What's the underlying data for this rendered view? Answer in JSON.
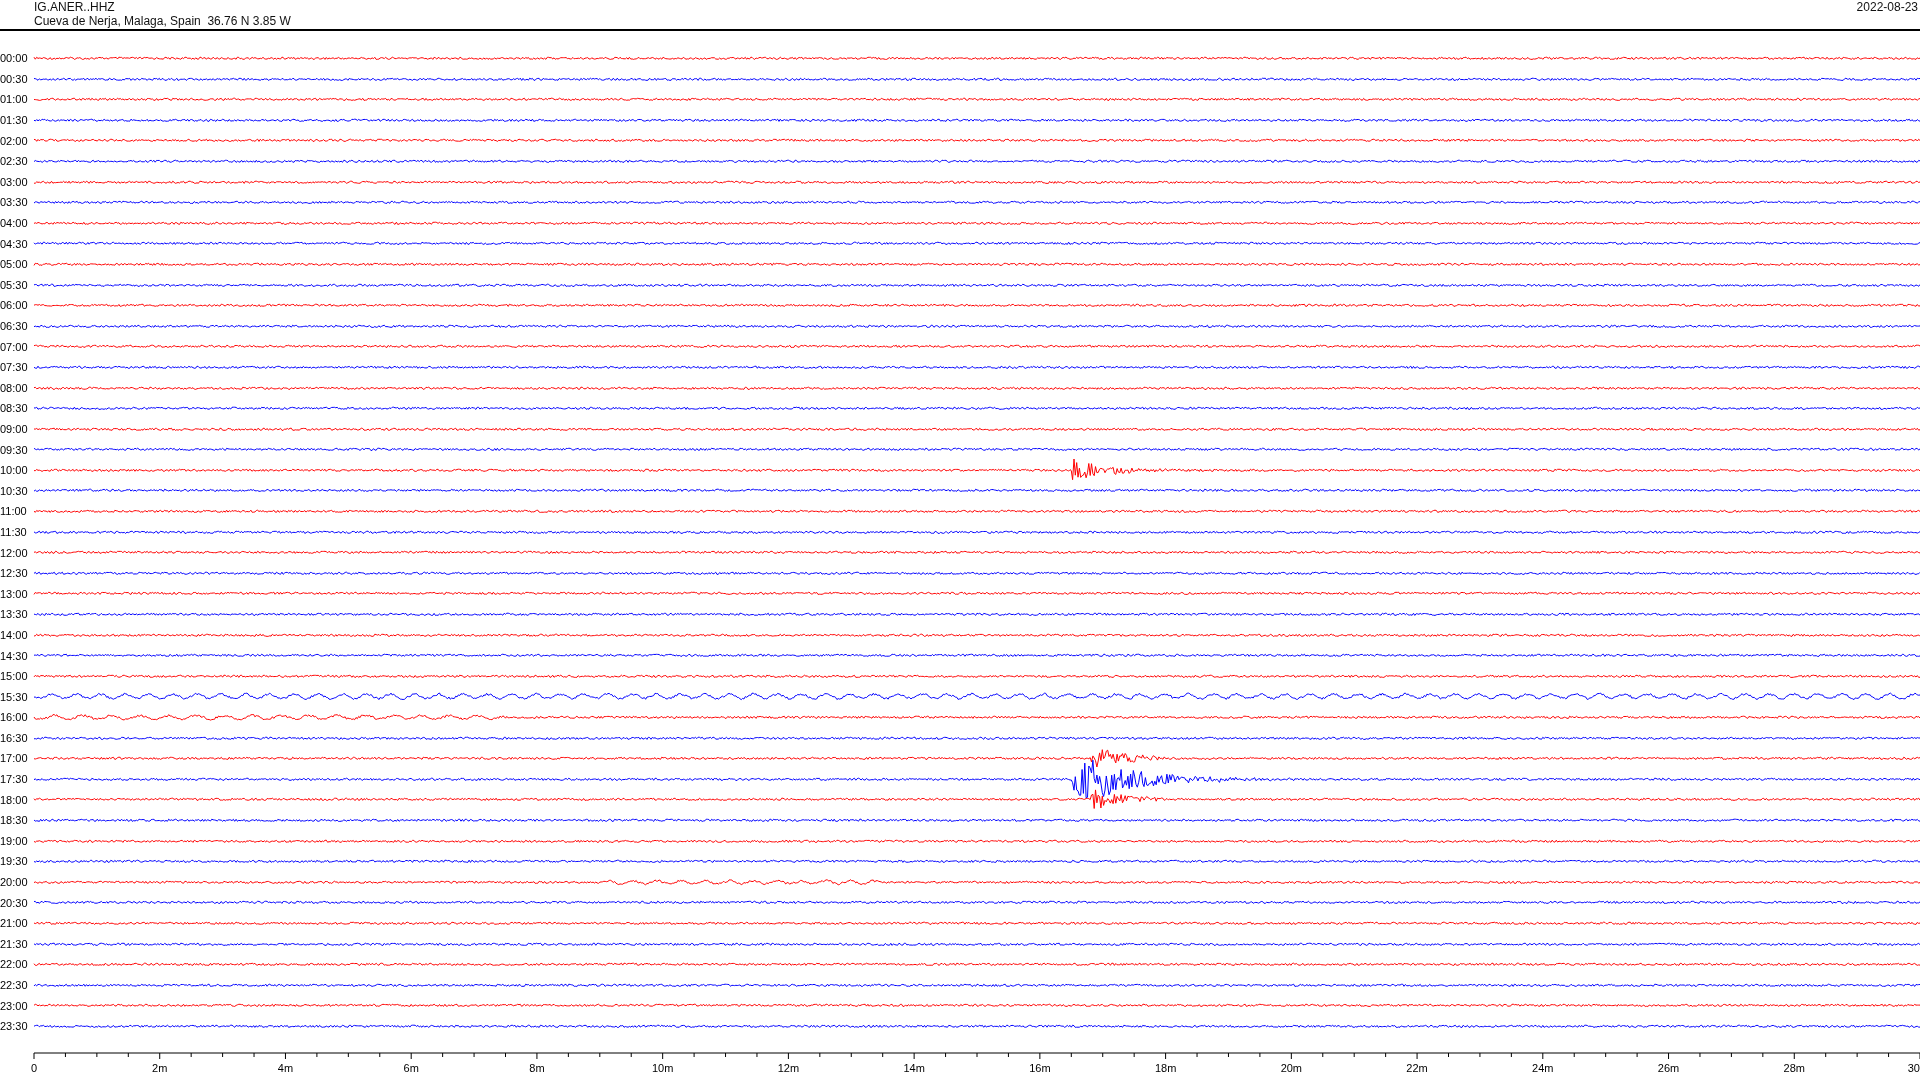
{
  "header": {
    "station": "IG.ANER..HHZ",
    "location": "Cueva de Nerja, Malaga, Spain  36.76 N 3.85 W",
    "date": "2022-08-23"
  },
  "traces": [
    {
      "time": "00:00",
      "color": "#ff0000"
    },
    {
      "time": "00:30",
      "color": "#0000ff"
    },
    {
      "time": "01:00",
      "color": "#ff0000"
    },
    {
      "time": "01:30",
      "color": "#0000ff"
    },
    {
      "time": "02:00",
      "color": "#ff0000"
    },
    {
      "time": "02:30",
      "color": "#0000ff"
    },
    {
      "time": "03:00",
      "color": "#ff0000"
    },
    {
      "time": "03:30",
      "color": "#0000ff"
    },
    {
      "time": "04:00",
      "color": "#ff0000"
    },
    {
      "time": "04:30",
      "color": "#0000ff"
    },
    {
      "time": "05:00",
      "color": "#ff0000"
    },
    {
      "time": "05:30",
      "color": "#0000ff"
    },
    {
      "time": "06:00",
      "color": "#ff0000"
    },
    {
      "time": "06:30",
      "color": "#0000ff"
    },
    {
      "time": "07:00",
      "color": "#ff0000"
    },
    {
      "time": "07:30",
      "color": "#0000ff"
    },
    {
      "time": "08:00",
      "color": "#ff0000"
    },
    {
      "time": "08:30",
      "color": "#0000ff"
    },
    {
      "time": "09:00",
      "color": "#ff0000"
    },
    {
      "time": "09:30",
      "color": "#0000ff"
    },
    {
      "time": "10:00",
      "color": "#ff0000"
    },
    {
      "time": "10:30",
      "color": "#0000ff"
    },
    {
      "time": "11:00",
      "color": "#ff0000"
    },
    {
      "time": "11:30",
      "color": "#0000ff"
    },
    {
      "time": "12:00",
      "color": "#ff0000"
    },
    {
      "time": "12:30",
      "color": "#0000ff"
    },
    {
      "time": "13:00",
      "color": "#ff0000"
    },
    {
      "time": "13:30",
      "color": "#0000ff"
    },
    {
      "time": "14:00",
      "color": "#ff0000"
    },
    {
      "time": "14:30",
      "color": "#0000ff"
    },
    {
      "time": "15:00",
      "color": "#ff0000"
    },
    {
      "time": "15:30",
      "color": "#0000ff"
    },
    {
      "time": "16:00",
      "color": "#ff0000"
    },
    {
      "time": "16:30",
      "color": "#0000ff"
    },
    {
      "time": "17:00",
      "color": "#ff0000"
    },
    {
      "time": "17:30",
      "color": "#0000ff"
    },
    {
      "time": "18:00",
      "color": "#ff0000"
    },
    {
      "time": "18:30",
      "color": "#0000ff"
    },
    {
      "time": "19:00",
      "color": "#ff0000"
    },
    {
      "time": "19:30",
      "color": "#0000ff"
    },
    {
      "time": "20:00",
      "color": "#ff0000"
    },
    {
      "time": "20:30",
      "color": "#0000ff"
    },
    {
      "time": "21:00",
      "color": "#ff0000"
    },
    {
      "time": "21:30",
      "color": "#0000ff"
    },
    {
      "time": "22:00",
      "color": "#ff0000"
    },
    {
      "time": "22:30",
      "color": "#0000ff"
    },
    {
      "time": "23:00",
      "color": "#ff0000"
    },
    {
      "time": "23:30",
      "color": "#0000ff"
    }
  ],
  "axis": {
    "labels": [
      "0",
      "2m",
      "4m",
      "6m",
      "8m",
      "10m",
      "12m",
      "14m",
      "16m",
      "18m",
      "20m",
      "22m",
      "24m",
      "26m",
      "28m",
      "30"
    ]
  }
}
